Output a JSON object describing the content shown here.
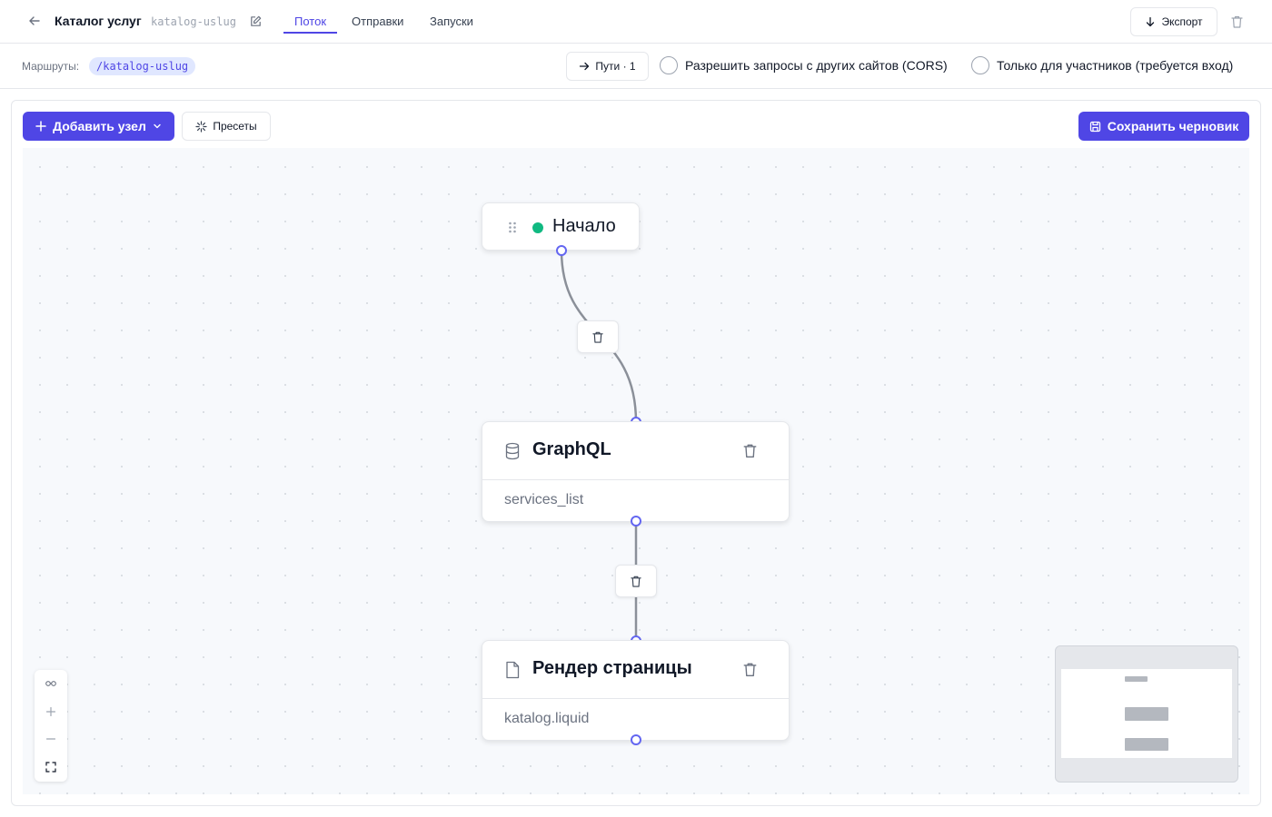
{
  "header": {
    "title": "Каталог услуг",
    "slug": "katalog-uslug",
    "tabs": [
      {
        "label": "Поток",
        "active": true
      },
      {
        "label": "Отправки",
        "active": false
      },
      {
        "label": "Запуски",
        "active": false
      }
    ],
    "export_label": "Экспорт"
  },
  "routes": {
    "label": "Маршруты:",
    "chip": "/katalog-uslug",
    "paths_label": "Пути · 1",
    "cors_label": "Разрешить запросы с других сайтов (CORS)",
    "members_label": "Только для участников (требуется вход)"
  },
  "toolbar": {
    "add_node_label": "Добавить узел",
    "presets_label": "Пресеты",
    "save_draft_label": "Сохранить черновик"
  },
  "flow": {
    "start": {
      "label": "Начало",
      "status_color": "#10b981"
    },
    "graphql": {
      "title": "GraphQL",
      "subtitle": "services_list",
      "icon": "database-icon"
    },
    "render": {
      "title": "Рендер страницы",
      "subtitle": "katalog.liquid",
      "icon": "file-icon"
    }
  },
  "colors": {
    "accent": "#4f46e5",
    "handle": "#6366f1",
    "edge": "#8b9099",
    "canvas": "#f7f9fc"
  }
}
